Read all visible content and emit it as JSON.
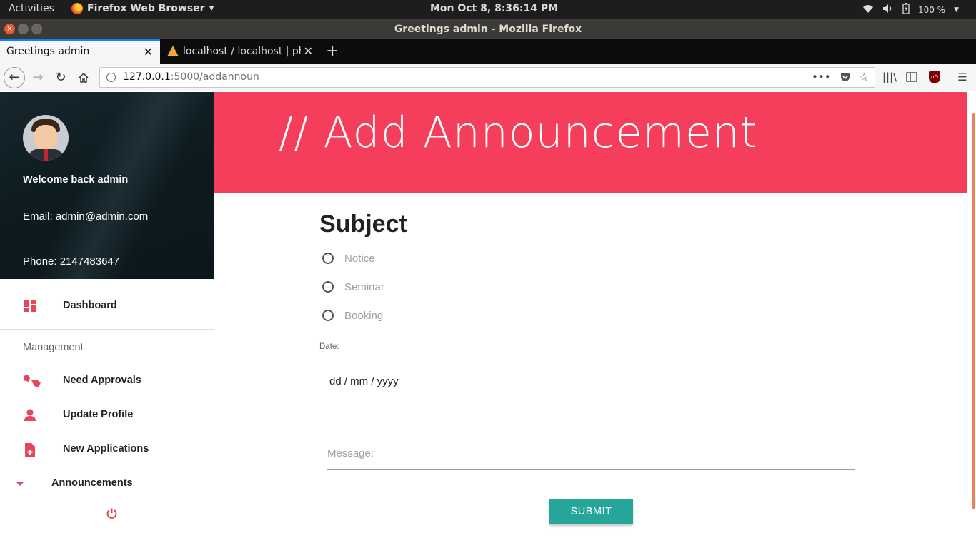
{
  "system_bar": {
    "activities": "Activities",
    "app_name": "Firefox Web Browser",
    "clock": "Mon Oct  8,  8:36:14 PM",
    "battery": "100 %"
  },
  "window": {
    "title": "Greetings admin - Mozilla Firefox"
  },
  "tabs": [
    {
      "label": "Greetings admin",
      "active": true
    },
    {
      "label": "localhost / localhost | ph",
      "active": false
    }
  ],
  "url_bar": {
    "host": "127.0.0.1",
    "path": ":5000/addannoun"
  },
  "sidebar": {
    "welcome": "Welcome back admin",
    "email": "Email: admin@admin.com",
    "phone": "Phone: 2147483647",
    "items": [
      {
        "label": "Dashboard",
        "icon": "dashboard-icon"
      },
      {
        "label": "Need Approvals",
        "icon": "thumbs-up-down-icon"
      },
      {
        "label": "Update Profile",
        "icon": "person-icon"
      },
      {
        "label": "New Applications",
        "icon": "note-add-icon"
      },
      {
        "label": "Announcements",
        "icon": "caret-down-icon"
      }
    ],
    "section_header": "Management",
    "accent_color": "#e8445a"
  },
  "main": {
    "title": "// Add Announcement",
    "banner_color": "#f53e5c",
    "subject_heading": "Subject",
    "radio_options": [
      "Notice",
      "Seminar",
      "Booking"
    ],
    "date_label": "Date:",
    "date_placeholder": "dd / mm / yyyy",
    "message_placeholder": "Message:",
    "submit_label": "SUBMIT",
    "submit_color": "#26a69a"
  }
}
